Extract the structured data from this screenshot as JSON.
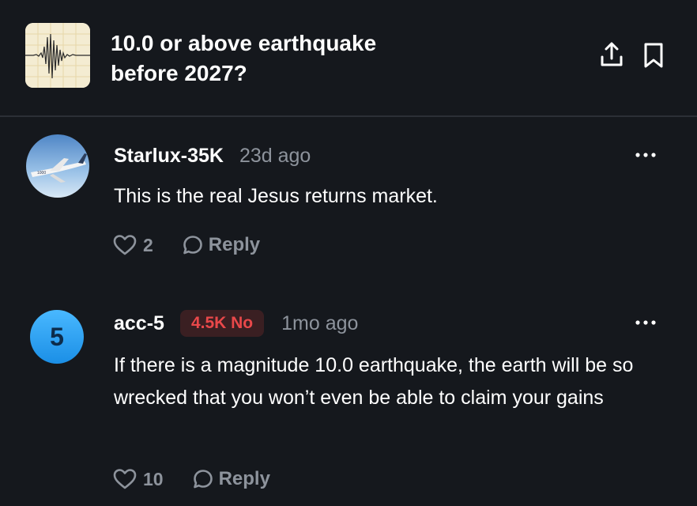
{
  "market": {
    "title_line1": "10.0 or above earthquake",
    "title_line2": "before 2027?",
    "thumbnail_icon": "seismograph-icon",
    "share_icon": "share-icon",
    "bookmark_icon": "bookmark-icon"
  },
  "comments": [
    {
      "username": "Starlux-35K",
      "time": "23d ago",
      "text": "This is the real Jesus returns market.",
      "likes": "2",
      "reply_label": "Reply",
      "avatar": "airplane-photo"
    },
    {
      "username": "acc-5",
      "avatar_text": "5",
      "badge": "4.5K No",
      "time": "1mo ago",
      "text": "If there is a magnitude 10.0 earthquake, the earth will be so wrecked that you won’t even be able to claim your gains",
      "likes": "10",
      "reply_label": "Reply"
    }
  ],
  "colors": {
    "background": "#15181d",
    "muted_text": "#8d939c",
    "badge_red": "#e9484a",
    "avatar_blue": "#2fa3f5"
  }
}
